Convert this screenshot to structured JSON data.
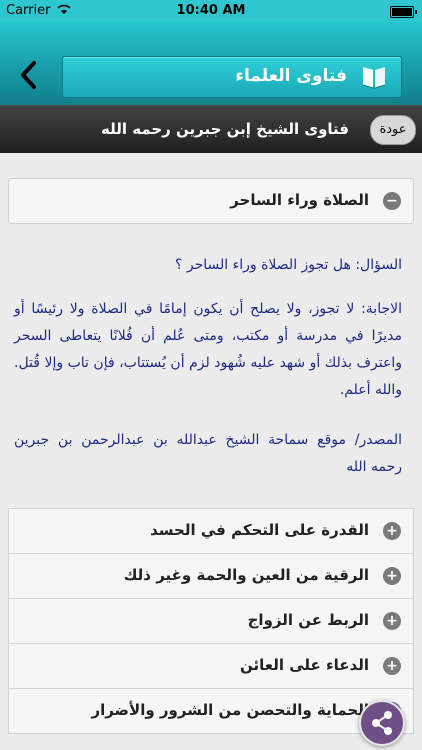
{
  "status": {
    "carrier": "Carrier",
    "time": "10:40 AM"
  },
  "header": {
    "title": "فتاوى العلماء",
    "back_icon": "chevron-left-icon",
    "title_icon": "book-icon"
  },
  "subbar": {
    "subtitle": "فتاوى الشيخ إبن جبرين رحمه الله",
    "back_label": "عودة"
  },
  "section": {
    "title": "الصلاة وراء الساحر",
    "question": "السؤال: هل تجوز الصلاة وراء الساحر ؟",
    "answer": "الاجابة: لا تجوز، ولا يصلح أن يكون إمامًا في الصلاة ولا رئيسًا أو مديرًا في مدرسة أو مكتب، ومتى عُلم أن فُلانًا يتعاطى السحر واعترف بذلك أو شهد عليه شُهود لزم أن يُستتاب، فإن تاب وإلا قُتل. والله أعلم.",
    "source": "المصدر/ موقع سماحة الشيخ عبدالله بن عبدالرحمن بن جبرين رحمه الله"
  },
  "items": [
    {
      "label": "القدرة على التحكم في الحسد"
    },
    {
      "label": "الرقية من العين والحمة وغير ذلك"
    },
    {
      "label": "الربط عن الزواج"
    },
    {
      "label": "الدعاء على العائن"
    },
    {
      "label": "الحماية والتحصن من الشرور والأضرار"
    }
  ],
  "colors": {
    "accent": "#1ba9b6",
    "content_text": "#1e2a87",
    "share": "#6f4f86"
  }
}
